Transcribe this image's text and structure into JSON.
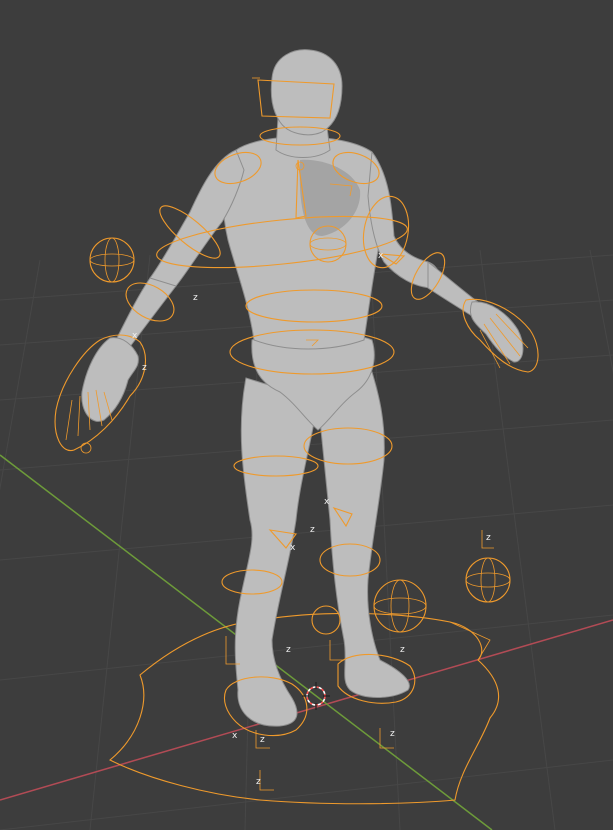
{
  "viewport": {
    "colors": {
      "background": "#3d3d3d",
      "grid": "#474747",
      "x_axis": "#b24b55",
      "y_axis": "#6d9b3a",
      "rig": "#ef9a2c",
      "mesh": "#bdbdbd"
    },
    "axis_labels": {
      "z": "z",
      "x": "x"
    }
  }
}
